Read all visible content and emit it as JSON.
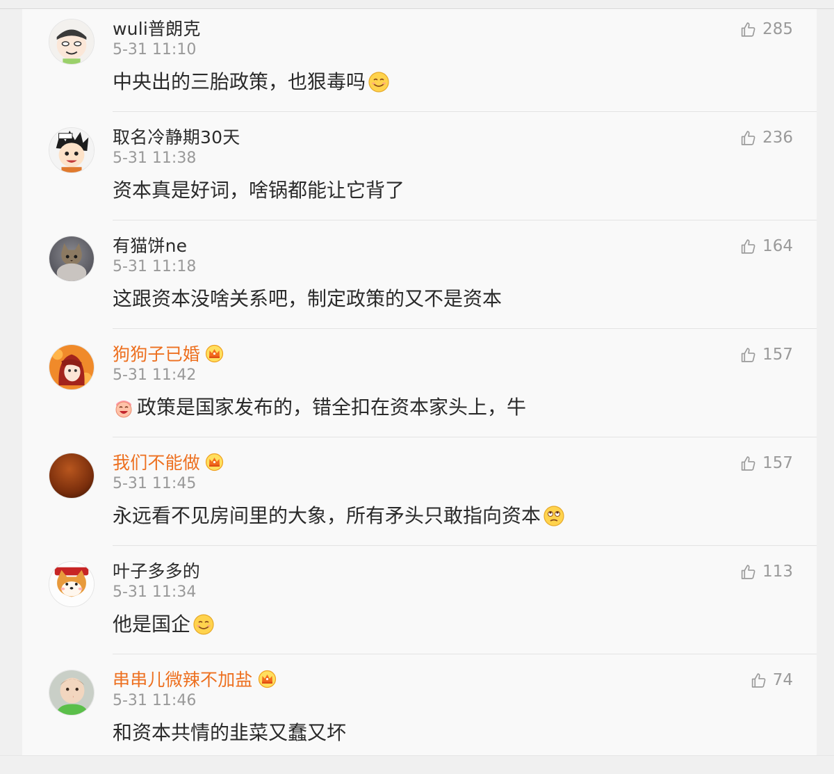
{
  "comments": [
    {
      "username": "wuli普朗克",
      "vip": false,
      "timestamp": "5-31 11:10",
      "text": "中央出的三胎政策，也狠毒吗",
      "emoji_before": "",
      "emoji_after": "smile-emoji-icon",
      "likes": "285",
      "avatar_icon": "cartoon-face-avatar"
    },
    {
      "username": "取名冷静期30天",
      "vip": false,
      "timestamp": "5-31 11:38",
      "text": "资本真是好词，啥锅都能让它背了",
      "emoji_before": "",
      "emoji_after": "",
      "likes": "236",
      "avatar_icon": "anime-boy-avatar"
    },
    {
      "username": "有猫饼ne",
      "vip": false,
      "timestamp": "5-31 11:18",
      "text": "这跟资本没啥关系吧，制定政策的又不是资本",
      "emoji_before": "",
      "emoji_after": "",
      "likes": "164",
      "avatar_icon": "cat-photo-avatar"
    },
    {
      "username": "狗狗子已婚",
      "vip": true,
      "timestamp": "5-31 11:42",
      "text": "政策是国家发布的，错全扣在资本家头上，牛",
      "emoji_before": "laughing-emoji-icon",
      "emoji_after": "",
      "likes": "157",
      "avatar_icon": "anime-redhair-avatar"
    },
    {
      "username": "我们不能做",
      "vip": true,
      "timestamp": "5-31 11:45",
      "text": "永远看不见房间里的大象，所有矛头只敢指向资本",
      "emoji_before": "",
      "emoji_after": "eyeroll-emoji-icon",
      "likes": "157",
      "avatar_icon": "brown-gradient-avatar"
    },
    {
      "username": "叶子多多的",
      "vip": false,
      "timestamp": "5-31 11:34",
      "text": "他是国企",
      "emoji_before": "",
      "emoji_after": "smile-emoji-icon",
      "likes": "113",
      "avatar_icon": "shiba-dog-avatar"
    },
    {
      "username": "串串儿微辣不加盐",
      "vip": true,
      "timestamp": "5-31 11:46",
      "text": "和资本共情的韭菜又蠢又坏",
      "emoji_before": "",
      "emoji_after": "",
      "likes": "74",
      "avatar_icon": "baby-photo-avatar"
    }
  ],
  "colors": {
    "vip_username": "#ed7020",
    "username": "#2b2b2b",
    "meta": "#999999",
    "panel_bg": "#f9f9f9",
    "page_bg": "#f0f0f0"
  }
}
